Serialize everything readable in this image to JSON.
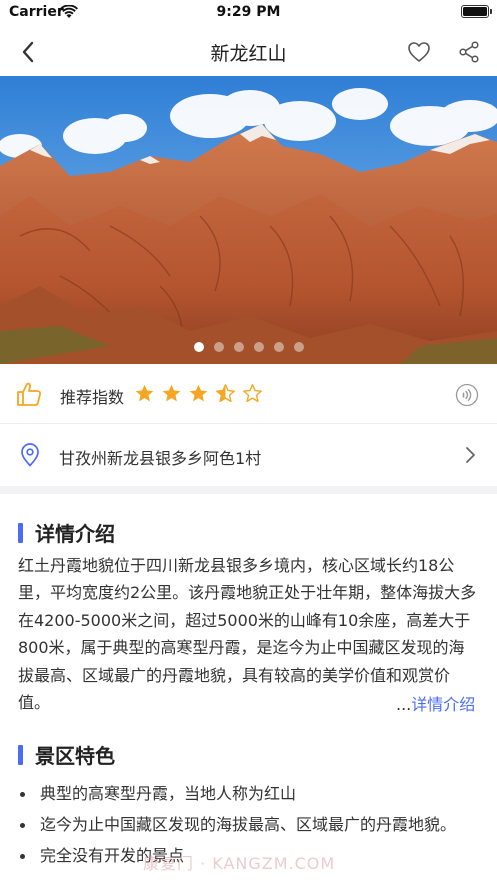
{
  "status_bar": {
    "carrier": "Carrier",
    "time": "9:29 PM"
  },
  "nav": {
    "title": "新龙红山"
  },
  "hero": {
    "slide_count": 6,
    "active_slide": 1
  },
  "rating": {
    "label": "推荐指数",
    "stars": 3.5,
    "max_stars": 5,
    "accent": "#f5a623"
  },
  "address": {
    "text": "甘孜州新龙县银多乡阿色1村"
  },
  "detail": {
    "title": "详情介绍",
    "body": "红土丹霞地貌位于四川新龙县银多乡境内，核心区域长约18公里，平均宽度约2公里。该丹霞地貌正处于壮年期，整体海拔大多在4200-5000米之间，超过5000米的山峰有10余座，高差大于800米，属于典型的高寒型丹霞，是迄今为止中国藏区发现的海拔最高、区域最广的丹霞地貌，具有较高的美学价值和观赏价值。",
    "more_prefix": "...",
    "more_label": "详情介绍"
  },
  "features": {
    "title": "景区特色",
    "items": [
      "典型的高寒型丹霞，当地人称为红山",
      "迄今为止中国藏区发现的海拔最高、区域最广的丹霞地貌。",
      "完全没有开发的景点"
    ]
  },
  "watermark": "康复门 · KANGZM.COM",
  "colors": {
    "accent_blue": "#4a6cf7",
    "star": "#f5a623"
  }
}
